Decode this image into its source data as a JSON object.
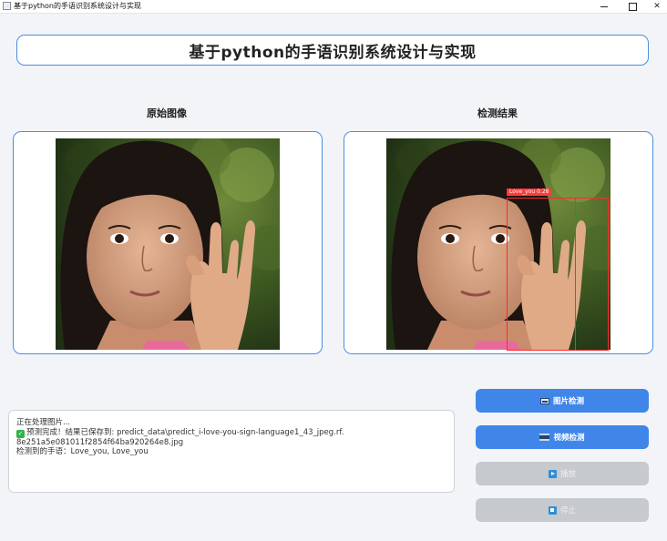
{
  "window": {
    "title": "基于python的手语识别系统设计与实现"
  },
  "header": {
    "title": "基于python的手语识别系统设计与实现"
  },
  "panels": {
    "original_label": "原始图像",
    "result_label": "检测结果",
    "detection": {
      "label": "Love_you",
      "confidence": "0.28"
    }
  },
  "log": {
    "lines": [
      "正在处理图片...",
      "预测完成！结果已保存到: predict_data\\predict_i-love-you-sign-language1_43_jpeg.rf.",
      "8e251a5e081011f2854f64ba920264e8.jpg",
      "检测到的手语：Love_you, Love_you"
    ]
  },
  "buttons": {
    "image_detect": "图片检测",
    "video_detect": "视频检测",
    "play": "播放",
    "stop": "停止"
  },
  "colors": {
    "accent": "#3f86e8",
    "panel_border": "#4a8ee0",
    "disabled": "#c6c9ce",
    "detection": "#ff2a2a",
    "success": "#2fb24a"
  }
}
